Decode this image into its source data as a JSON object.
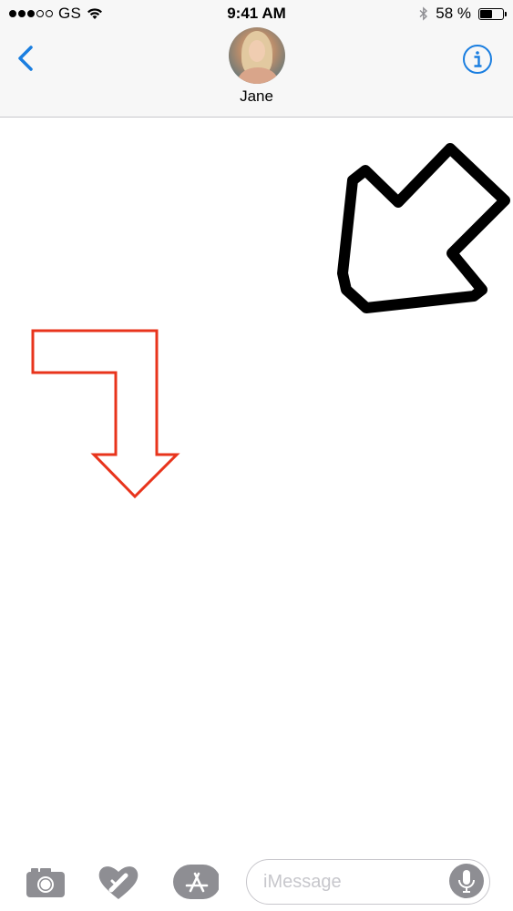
{
  "status_bar": {
    "carrier": "GS",
    "time": "9:41 AM",
    "battery": "58 %",
    "battery_level": 0.58,
    "signal_bars_filled": 3,
    "signal_bars_total": 5
  },
  "header": {
    "contact_name": "Jane",
    "back_icon": "chevron-left-icon",
    "info_icon": "info-circle-icon",
    "accent_color": "#1a7ee0"
  },
  "canvas": {
    "black_arrow_color": "#000000",
    "red_arrow_color": "#e8341c"
  },
  "toolbar": {
    "camera_icon": "camera-icon",
    "digital_touch_icon": "digital-touch-heart-icon",
    "apps_icon": "app-store-icon",
    "message_placeholder": "iMessage",
    "mic_icon": "microphone-icon"
  }
}
